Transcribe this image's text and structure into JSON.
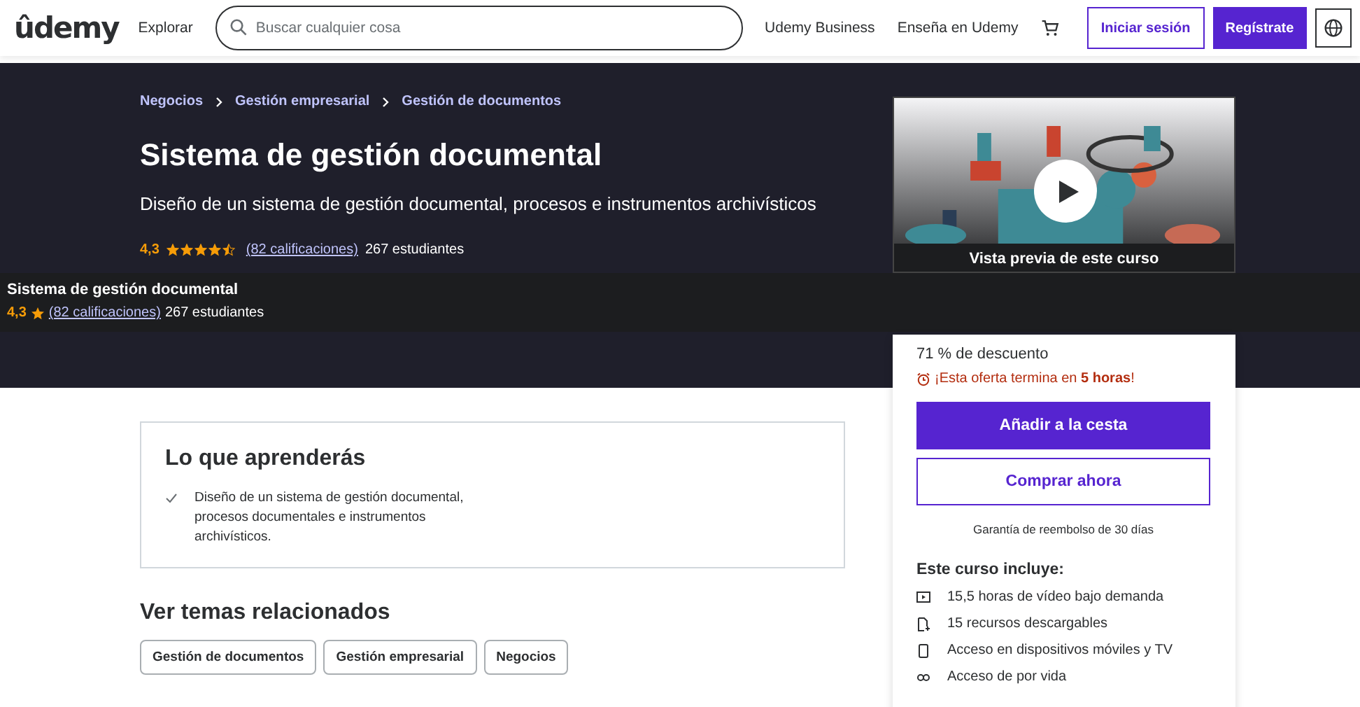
{
  "header": {
    "logo": "ûdemy",
    "explore": "Explorar",
    "search": {
      "placeholder": "Buscar cualquier cosa"
    },
    "links": [
      "Udemy Business",
      "Enseña en Udemy"
    ],
    "login": "Iniciar sesión",
    "signup": "Regístrate"
  },
  "breadcrumb": [
    "Negocios",
    "Gestión empresarial",
    "Gestión de documentos"
  ],
  "course": {
    "title": "Sistema de gestión documental",
    "subtitle": "Diseño de un sistema de gestión documental, procesos e instrumentos archivísticos",
    "rating": "4,3",
    "stars": 4.5,
    "ratings_link": "(82 calificaciones)",
    "students": "267 estudiantes"
  },
  "sticky_bar": {
    "title": "Sistema de gestión documental",
    "rating": "4,3",
    "ratings_link": "(82 calificaciones)",
    "students": "267 estudiantes"
  },
  "preview": {
    "kind": "picture",
    "caption": "Vista previa de este curso"
  },
  "purchase": {
    "discount": "71 % de descuento",
    "offer": "¡Esta oferta termina en **5 horas**!",
    "add_to_cart": "Añadir a la cesta",
    "buy_now": "Comprar ahora",
    "guarantee": "Garantía de reembolso de 30 días",
    "includes_title": "Este curso incluye:",
    "includes": [
      {
        "kind": "video",
        "text": "15,5 horas de vídeo bajo demanda"
      },
      {
        "kind": "file",
        "text": "15 recursos descargables"
      },
      {
        "kind": "mobile",
        "text": "Acceso en dispositivos móviles y TV"
      },
      {
        "kind": "infinity",
        "text": "Acceso de por vida"
      }
    ]
  },
  "learn": {
    "title": "Lo que aprenderás",
    "items": [
      "Diseño de un sistema de gestión documental, procesos documentales e instrumentos archivísticos."
    ]
  },
  "related": {
    "title": "Ver temas relacionados",
    "topics": [
      "Gestión de documentos",
      "Gestión empresarial",
      "Negocios"
    ]
  }
}
